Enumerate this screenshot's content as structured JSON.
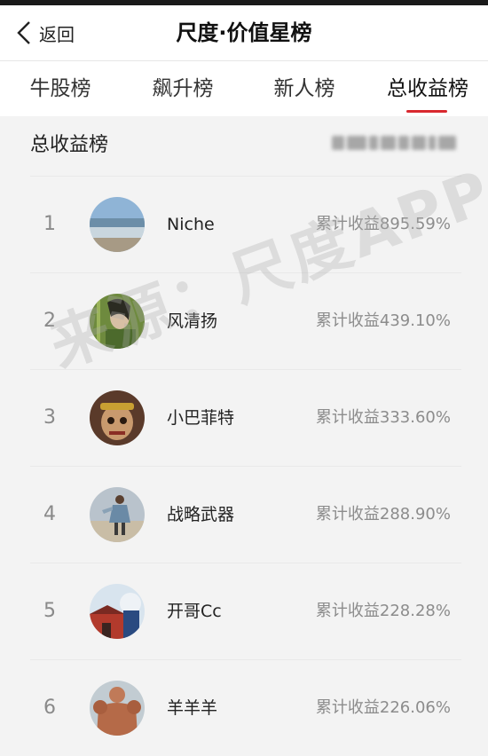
{
  "header": {
    "back_label": "返回",
    "title": "尺度·价值星榜"
  },
  "tabs": [
    {
      "label": "牛股榜",
      "active": false
    },
    {
      "label": "飙升榜",
      "active": false
    },
    {
      "label": "新人榜",
      "active": false
    },
    {
      "label": "总收益榜",
      "active": true
    }
  ],
  "section": {
    "title": "总收益榜"
  },
  "ranking": [
    {
      "rank": "1",
      "name": "Niche",
      "gain": "累计收益895.59%",
      "avatar": "beach-photo"
    },
    {
      "rank": "2",
      "name": "风清扬",
      "gain": "累计收益439.10%",
      "avatar": "swordsman-portrait"
    },
    {
      "rank": "3",
      "name": "小巴菲特",
      "gain": "累计收益333.60%",
      "avatar": "monkey-king-portrait"
    },
    {
      "rank": "4",
      "name": "战略武器",
      "gain": "累计收益288.90%",
      "avatar": "beach-person-photo"
    },
    {
      "rank": "5",
      "name": "开哥Cc",
      "gain": "累计收益228.28%",
      "avatar": "city-gate-photo"
    },
    {
      "rank": "6",
      "name": "羊羊羊",
      "gain": "累计收益226.06%",
      "avatar": "bodybuilder-photo"
    }
  ],
  "watermark": "来源：尺度APP",
  "colors": {
    "accent": "#d9292f",
    "background": "#f3f3f3",
    "rank_text": "#8a8a8a",
    "gain_text": "#8c8c8c"
  }
}
